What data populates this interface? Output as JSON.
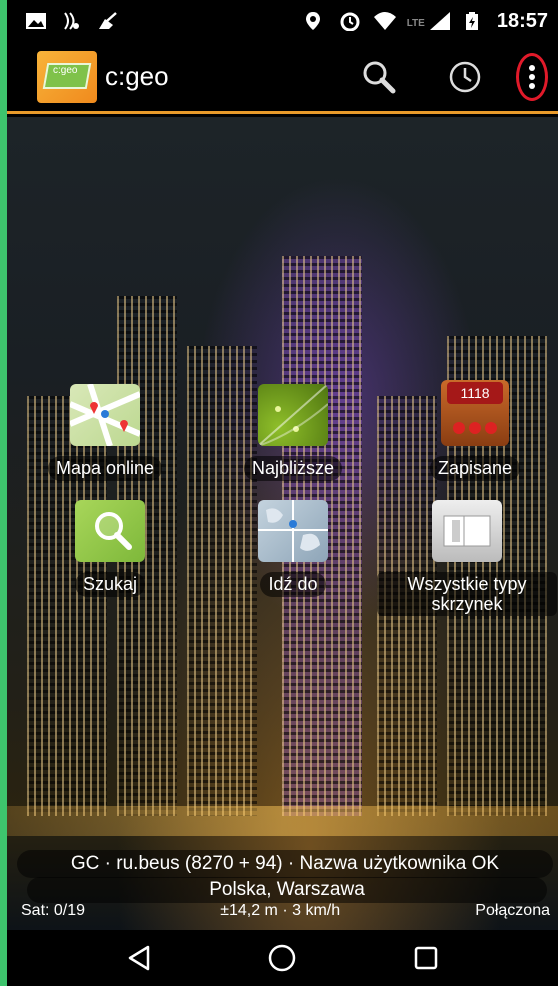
{
  "status_bar": {
    "time": "18:57",
    "network": "LTE"
  },
  "app": {
    "title": "c:geo",
    "logo_text": "c:geo"
  },
  "menu": [
    {
      "label": "Mapa online"
    },
    {
      "label": "Najbliższe"
    },
    {
      "label": "Zapisane",
      "badge": "1118"
    },
    {
      "label": "Szukaj"
    },
    {
      "label": "Idź do"
    },
    {
      "label": "Wszystkie typy skrzynek"
    }
  ],
  "info": {
    "line1": "GC · ru.beus (8270 + 94) · Nazwa użytkownika OK",
    "line2": "Polska, Warszawa",
    "satellites": "Sat: 0/19",
    "accuracy": "±14,2 m · 3 km/h",
    "connection": "Połączona"
  },
  "colors": {
    "accent": "#e89a2a",
    "highlight": "#e11a2a",
    "frame": "#3ec46d"
  }
}
